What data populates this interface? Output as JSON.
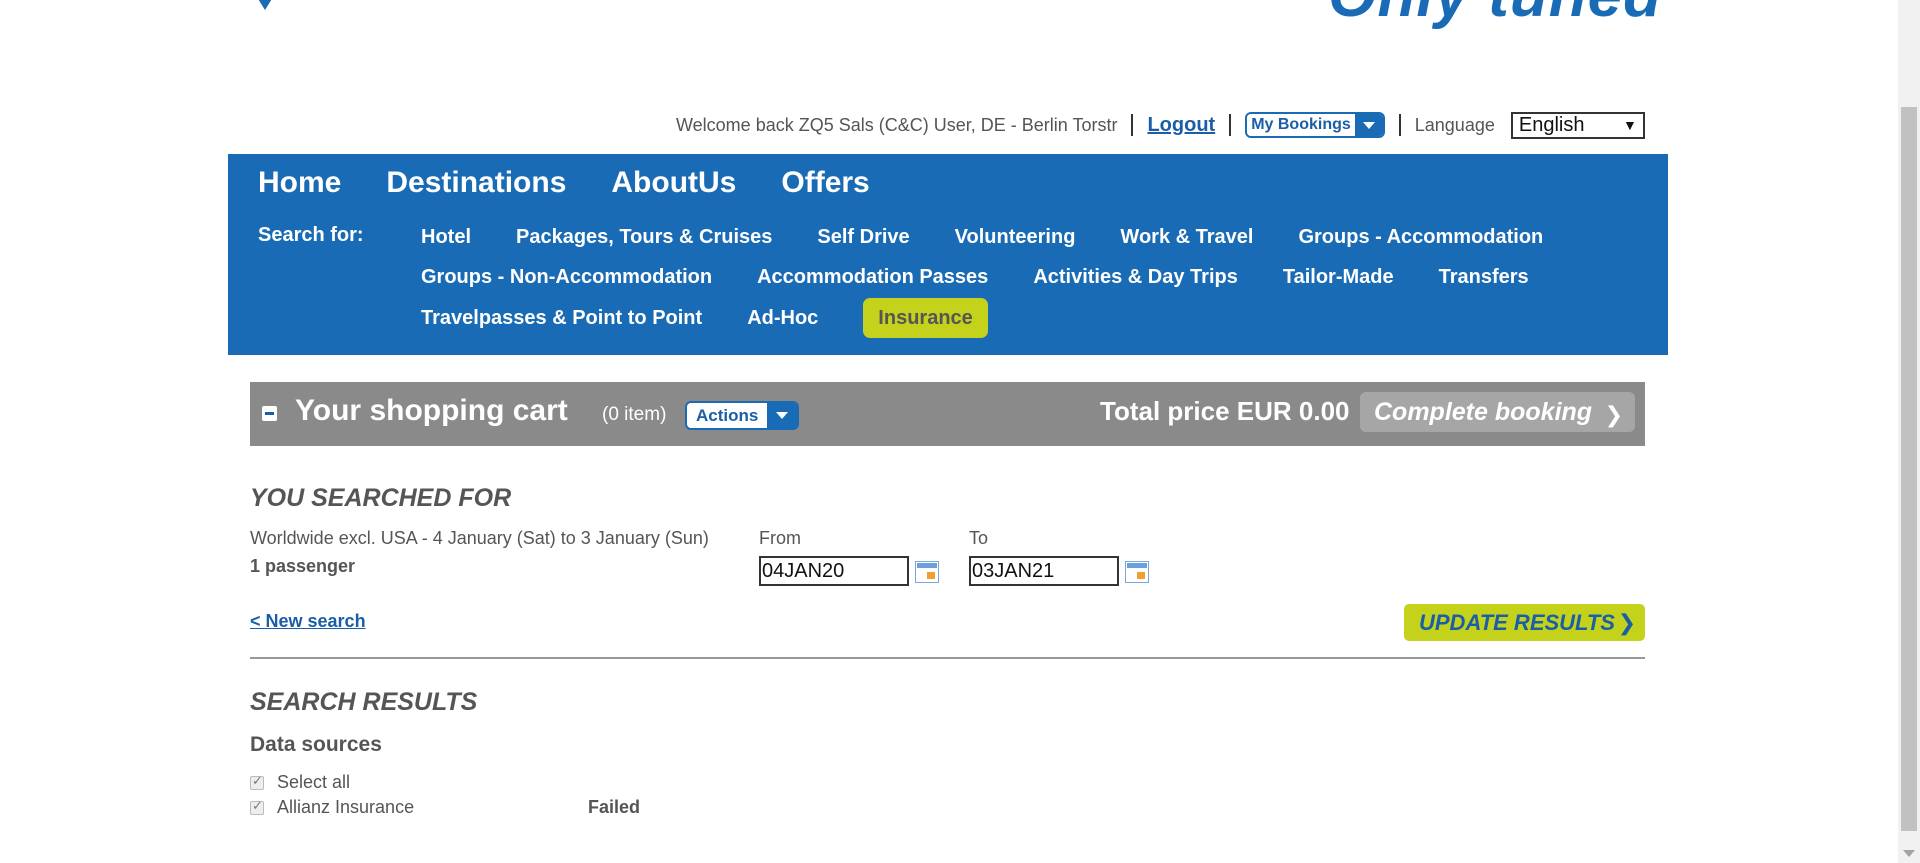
{
  "header": {
    "welcome": "Welcome back ZQ5 Sals (C&C) User, DE - Berlin Torstr",
    "logout": "Logout",
    "my_bookings": "My Bookings",
    "language_label": "Language",
    "language_value": "English"
  },
  "nav": {
    "main": [
      "Home",
      "Destinations",
      "AboutUs",
      "Offers"
    ],
    "search_for": "Search for:",
    "row1": [
      "Hotel",
      "Packages, Tours & Cruises",
      "Self Drive",
      "Volunteering",
      "Work & Travel",
      "Groups - Accommodation"
    ],
    "row2": [
      "Groups - Non-Accommodation",
      "Accommodation Passes",
      "Activities & Day Trips",
      "Tailor-Made",
      "Transfers"
    ],
    "row3": [
      "Travelpasses & Point to Point",
      "Ad-Hoc",
      "Insurance"
    ],
    "active": "Insurance"
  },
  "cart": {
    "title": "Your shopping cart",
    "count": "(0 item)",
    "actions": "Actions",
    "total": "Total price EUR 0.00",
    "complete": "Complete booking"
  },
  "search": {
    "heading": "YOU SEARCHED FOR",
    "summary": "Worldwide excl. USA - 4 January (Sat) to 3 January (Sun)",
    "passengers": "1 passenger",
    "from_label": "From",
    "from_value": "04JAN20",
    "to_label": "To",
    "to_value": "03JAN21",
    "new_search": "< New search",
    "update": "UPDATE RESULTS"
  },
  "results": {
    "heading": "SEARCH RESULTS",
    "data_sources": "Data sources",
    "select_all": "Select all",
    "sources": [
      {
        "name": "Allianz Insurance",
        "status": "Failed"
      }
    ]
  },
  "colors": {
    "brand_blue": "#1a6bb5",
    "accent_lime": "#c4d21c",
    "cart_grey": "#8a8a8a"
  }
}
